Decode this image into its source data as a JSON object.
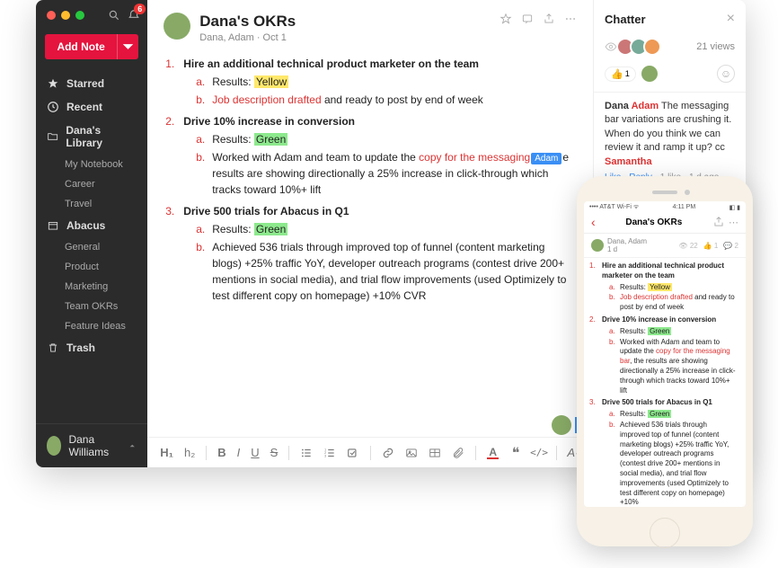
{
  "sidebar": {
    "notif_count": "6",
    "add_note": "Add Note",
    "items": [
      {
        "icon": "star",
        "label": "Starred"
      },
      {
        "icon": "clock",
        "label": "Recent"
      },
      {
        "icon": "folder",
        "label": "Dana's Library"
      },
      {
        "icon": "sub",
        "label": "My Notebook"
      },
      {
        "icon": "sub",
        "label": "Career"
      },
      {
        "icon": "sub",
        "label": "Travel"
      },
      {
        "icon": "box",
        "label": "Abacus"
      },
      {
        "icon": "sub",
        "label": "General"
      },
      {
        "icon": "sub",
        "label": "Product"
      },
      {
        "icon": "sub",
        "label": "Marketing"
      },
      {
        "icon": "sub",
        "label": "Team OKRs"
      },
      {
        "icon": "sub",
        "label": "Feature Ideas"
      },
      {
        "icon": "trash",
        "label": "Trash"
      }
    ],
    "user": "Dana Williams"
  },
  "doc": {
    "title": "Dana's OKRs",
    "authors": "Dana, Adam · Oct 1",
    "okrs": [
      {
        "num": "1.",
        "title": "Hire an additional technical product marketer on the team",
        "subs": [
          {
            "let": "a.",
            "pre": "Results: ",
            "hl": "Yellow",
            "hlclass": "hl-y"
          },
          {
            "let": "b.",
            "red": "Job description drafted",
            "post": " and ready to post by end of week"
          }
        ]
      },
      {
        "num": "2.",
        "title": "Drive 10% increase in conversion",
        "subs": [
          {
            "let": "a.",
            "pre": "Results: ",
            "hl": "Green",
            "hlclass": "hl-g"
          },
          {
            "let": "b.",
            "plain_pre": "Worked with Adam and team to update the ",
            "red": "copy for the messaging",
            "tag": "Adam",
            "plain_post": "e results are showing directionally a 25% increase in click-through which tracks toward 10%+ lift"
          }
        ]
      },
      {
        "num": "3.",
        "title": "Drive 500 trials for Abacus in Q1",
        "subs": [
          {
            "let": "a.",
            "pre": "Results: ",
            "hl": "Green",
            "hlclass": "hl-g"
          },
          {
            "let": "b.",
            "plain": "Achieved 536 trials through improved top of funnel (content marketing blogs) +25% traffic YoY,  developer outreach programs (contest drive 200+ mentions in social media), and trial flow improvements (used Optimizely to test different copy on homepage) +10% CVR"
          }
        ]
      }
    ]
  },
  "chatter": {
    "title": "Chatter",
    "views": "21 views",
    "react_count": "1",
    "comment": {
      "author": "Dana ",
      "author2": "Adam",
      "body": " The messaging bar variations are crushing it. When do you think we can review it and ramp it up? cc ",
      "mention": "Samantha",
      "like": "Like",
      "reply": "Reply",
      "meta": "1 like · 1 d ago"
    }
  },
  "phone": {
    "carrier": "AT&T Wi-Fi",
    "time": "4:11 PM",
    "title": "Dana's OKRs",
    "authors": "Dana, Adam",
    "age": "1 d",
    "views": "22",
    "likes": "1",
    "comments": "2",
    "okrs": [
      {
        "num": "1.",
        "title": "Hire an additional technical product marketer on the team",
        "subs": [
          {
            "let": "a.",
            "pre": "Results: ",
            "hl": "Yellow",
            "hlclass": "hl-y"
          },
          {
            "let": "b.",
            "red": "Job description drafted",
            "post": " and ready to post by end of week"
          }
        ]
      },
      {
        "num": "2.",
        "title": "Drive 10% increase in conversion",
        "subs": [
          {
            "let": "a.",
            "pre": "Results: ",
            "hl": "Green",
            "hlclass": "hl-g"
          },
          {
            "let": "b.",
            "plain_pre": "Worked with Adam and team to update the ",
            "red": "copy for the messaging bar",
            "plain_post": ", the results are showing directionally a 25% increase in click-through which tracks toward 10%+ lift"
          }
        ]
      },
      {
        "num": "3.",
        "title": "Drive 500 trials for Abacus in Q1",
        "subs": [
          {
            "let": "a.",
            "pre": "Results: ",
            "hl": "Green",
            "hlclass": "hl-g"
          },
          {
            "let": "b.",
            "plain": "Achieved 536 trials through improved top of funnel (content marketing blogs) +25% traffic YoY,  developer outreach programs (contest drive 200+ mentions in social media), and trial flow improvements (used Optimizely to test different copy on homepage) +10%"
          }
        ]
      }
    ]
  },
  "toolbar": {
    "h1": "H₁",
    "h2": "h₂",
    "b": "B",
    "i": "I",
    "u": "U",
    "s": "S"
  }
}
